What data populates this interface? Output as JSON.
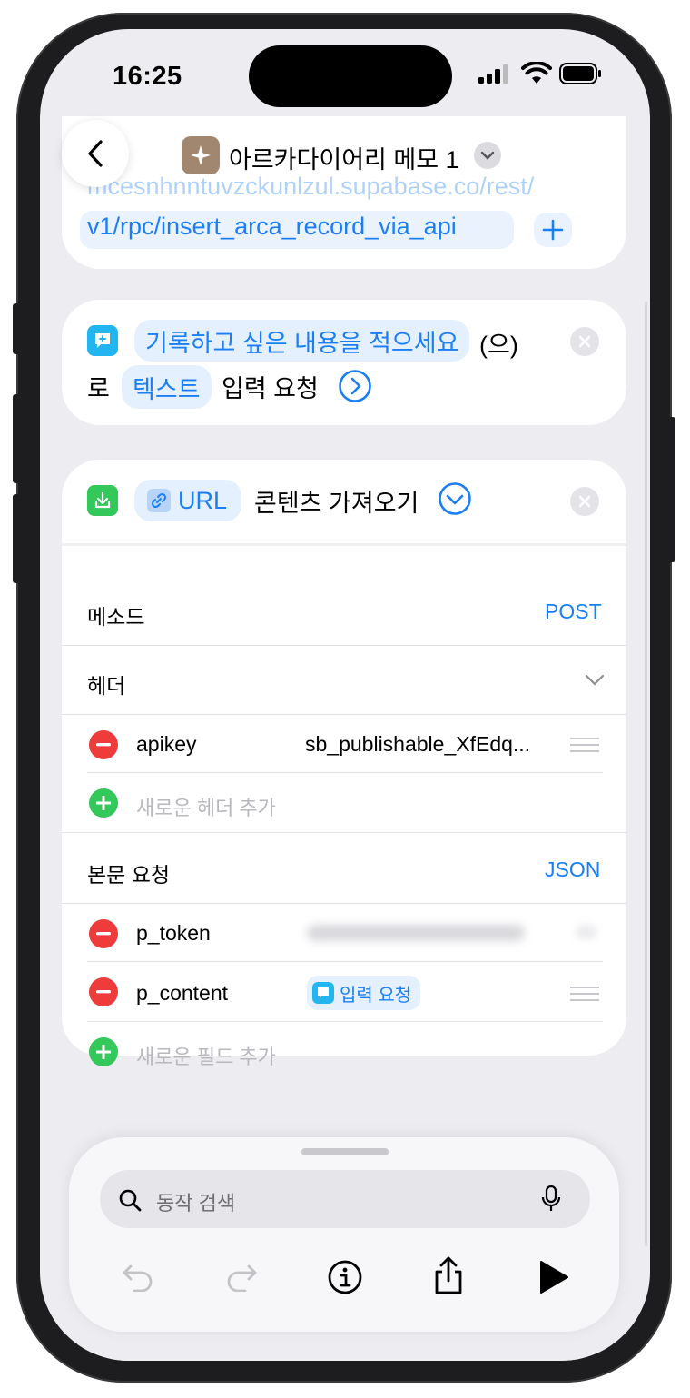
{
  "status": {
    "time": "16:25"
  },
  "header": {
    "shortcut_title": "아르카다이어리 메모 1",
    "url_line1": "mcesnhnntuvzckunlzul.supabase.co/rest/",
    "url_line2": "v1/rpc/insert_arca_record_via_api"
  },
  "ask_action": {
    "prompt_chip": "기록하고 싶은 내용을 적으세요",
    "text_suffix": "(으)",
    "text_ro": "로",
    "type_chip": "텍스트",
    "action_label": "입력 요청"
  },
  "fetch_action": {
    "url_chip": "URL",
    "action_label": "콘텐츠 가져오기",
    "method_label": "메소드",
    "method_value": "POST",
    "headers_label": "헤더",
    "headers": [
      {
        "key": "apikey",
        "value": "sb_publishable_XfEdq..."
      }
    ],
    "add_header": "새로운 헤더 추가",
    "body_label": "본문 요청",
    "body_type": "JSON",
    "fields": [
      {
        "key": "p_token",
        "value": ""
      },
      {
        "key": "p_content",
        "value_chip": "입력 요청"
      }
    ],
    "add_field": "새로운 필드 추가"
  },
  "bottom": {
    "search_placeholder": "동작 검색"
  },
  "colors": {
    "accent": "#1a7ef5",
    "danger": "#ee3b3b",
    "success": "#34c759"
  }
}
